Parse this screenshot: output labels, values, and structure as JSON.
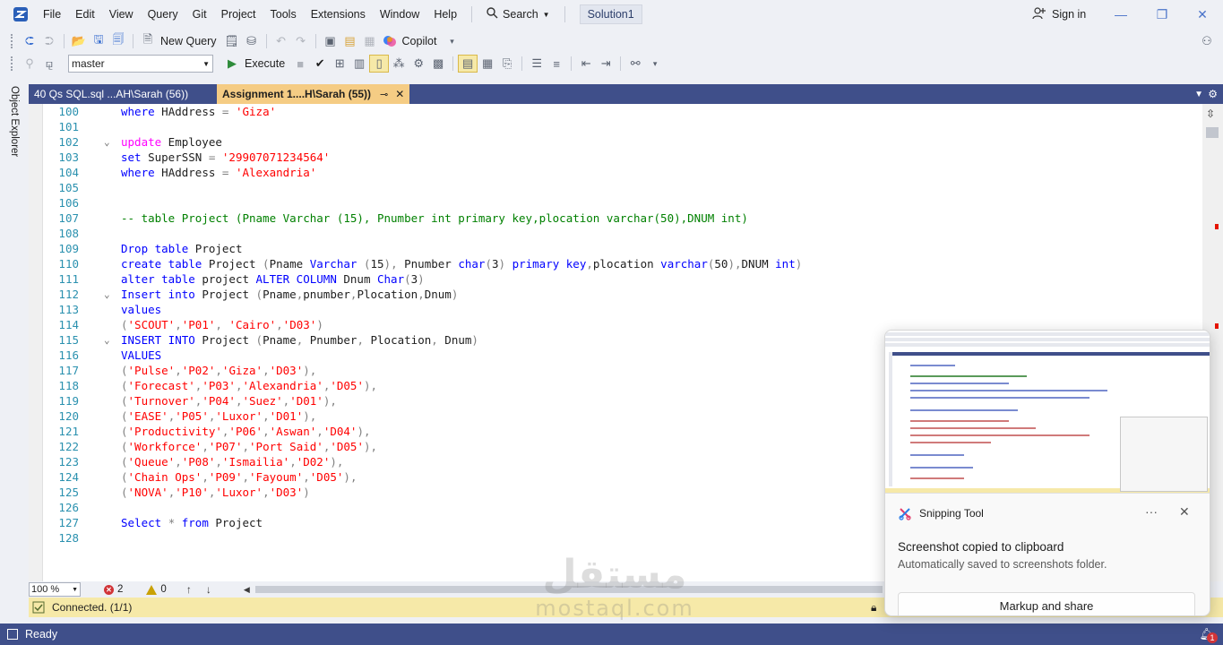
{
  "menubar": {
    "items": [
      "File",
      "Edit",
      "View",
      "Query",
      "Git",
      "Project",
      "Tools",
      "Extensions",
      "Window",
      "Help"
    ],
    "search_label": "Search",
    "solution_name": "Solution1",
    "signin_label": "Sign in"
  },
  "toolbar": {
    "new_query_label": "New Query",
    "copilot_label": "Copilot",
    "database": "master",
    "execute_label": "Execute"
  },
  "side_panel": {
    "label": "Object Explorer"
  },
  "tabs": [
    {
      "label": "40 Qs SQL.sql ...AH\\Sarah (56))",
      "active": false
    },
    {
      "label": "Assignment 1....H\\Sarah (55))",
      "active": true
    }
  ],
  "editor": {
    "lines": [
      {
        "num": "100",
        "tokens": [
          {
            "t": "k",
            "v": "where"
          },
          {
            "t": "t",
            "v": " HAddress "
          },
          {
            "t": "g",
            "v": "="
          },
          {
            "t": "t",
            "v": " "
          },
          {
            "t": "s",
            "v": "'Giza'"
          }
        ]
      },
      {
        "num": "101",
        "tokens": []
      },
      {
        "num": "102",
        "fold": true,
        "tokens": [
          {
            "t": "f",
            "v": "update"
          },
          {
            "t": "t",
            "v": " Employee"
          }
        ]
      },
      {
        "num": "103",
        "tokens": [
          {
            "t": "k",
            "v": "set"
          },
          {
            "t": "t",
            "v": " SuperSSN "
          },
          {
            "t": "g",
            "v": "="
          },
          {
            "t": "t",
            "v": " "
          },
          {
            "t": "s",
            "v": "'29907071234564'"
          }
        ]
      },
      {
        "num": "104",
        "tokens": [
          {
            "t": "k",
            "v": "where"
          },
          {
            "t": "t",
            "v": " HAddress "
          },
          {
            "t": "g",
            "v": "="
          },
          {
            "t": "t",
            "v": " "
          },
          {
            "t": "s",
            "v": "'Alexandria'"
          }
        ]
      },
      {
        "num": "105",
        "tokens": []
      },
      {
        "num": "106",
        "tokens": []
      },
      {
        "num": "107",
        "tokens": [
          {
            "t": "c",
            "v": "-- table Project (Pname Varchar (15), Pnumber int primary key,plocation varchar(50),DNUM int)"
          }
        ]
      },
      {
        "num": "108",
        "tokens": []
      },
      {
        "num": "109",
        "tokens": [
          {
            "t": "k",
            "v": "Drop table"
          },
          {
            "t": "t",
            "v": " Project"
          }
        ]
      },
      {
        "num": "110",
        "tokens": [
          {
            "t": "k",
            "v": "create table"
          },
          {
            "t": "t",
            "v": " Project "
          },
          {
            "t": "g",
            "v": "("
          },
          {
            "t": "t",
            "v": "Pname "
          },
          {
            "t": "k",
            "v": "Varchar"
          },
          {
            "t": "t",
            "v": " "
          },
          {
            "t": "g",
            "v": "("
          },
          {
            "t": "t",
            "v": "15"
          },
          {
            "t": "g",
            "v": "),"
          },
          {
            "t": "t",
            "v": " Pnumber "
          },
          {
            "t": "k",
            "v": "char"
          },
          {
            "t": "g",
            "v": "("
          },
          {
            "t": "t",
            "v": "3"
          },
          {
            "t": "g",
            "v": ")"
          },
          {
            "t": "t",
            "v": " "
          },
          {
            "t": "k",
            "v": "primary key"
          },
          {
            "t": "g",
            "v": ","
          },
          {
            "t": "t",
            "v": "plocation "
          },
          {
            "t": "k",
            "v": "varchar"
          },
          {
            "t": "g",
            "v": "("
          },
          {
            "t": "t",
            "v": "50"
          },
          {
            "t": "g",
            "v": "),"
          },
          {
            "t": "t",
            "v": "DNUM "
          },
          {
            "t": "k",
            "v": "int"
          },
          {
            "t": "g",
            "v": ")"
          }
        ]
      },
      {
        "num": "111",
        "tokens": [
          {
            "t": "k",
            "v": "alter table"
          },
          {
            "t": "t",
            "v": " project "
          },
          {
            "t": "k",
            "v": "ALTER COLUMN"
          },
          {
            "t": "t",
            "v": " Dnum "
          },
          {
            "t": "k",
            "v": "Char"
          },
          {
            "t": "g",
            "v": "("
          },
          {
            "t": "t",
            "v": "3"
          },
          {
            "t": "g",
            "v": ")"
          }
        ]
      },
      {
        "num": "112",
        "fold": true,
        "tokens": [
          {
            "t": "k",
            "v": "Insert into"
          },
          {
            "t": "t",
            "v": " Project "
          },
          {
            "t": "g",
            "v": "("
          },
          {
            "t": "t",
            "v": "Pname"
          },
          {
            "t": "g",
            "v": ","
          },
          {
            "t": "t",
            "v": "pnumber"
          },
          {
            "t": "g",
            "v": ","
          },
          {
            "t": "t",
            "v": "Plocation"
          },
          {
            "t": "g",
            "v": ","
          },
          {
            "t": "t",
            "v": "Dnum"
          },
          {
            "t": "g",
            "v": ")"
          }
        ]
      },
      {
        "num": "113",
        "tokens": [
          {
            "t": "k",
            "v": "values"
          }
        ]
      },
      {
        "num": "114",
        "tokens": [
          {
            "t": "g",
            "v": "("
          },
          {
            "t": "s",
            "v": "'SCOUT'"
          },
          {
            "t": "g",
            "v": ","
          },
          {
            "t": "s",
            "v": "'P01'"
          },
          {
            "t": "g",
            "v": ","
          },
          {
            "t": "t",
            "v": " "
          },
          {
            "t": "s",
            "v": "'Cairo'"
          },
          {
            "t": "g",
            "v": ","
          },
          {
            "t": "s",
            "v": "'D03'"
          },
          {
            "t": "g",
            "v": ")"
          }
        ]
      },
      {
        "num": "115",
        "fold": true,
        "tokens": [
          {
            "t": "k",
            "v": "INSERT INTO"
          },
          {
            "t": "t",
            "v": " Project "
          },
          {
            "t": "g",
            "v": "("
          },
          {
            "t": "t",
            "v": "Pname"
          },
          {
            "t": "g",
            "v": ","
          },
          {
            "t": "t",
            "v": " Pnumber"
          },
          {
            "t": "g",
            "v": ","
          },
          {
            "t": "t",
            "v": " Plocation"
          },
          {
            "t": "g",
            "v": ","
          },
          {
            "t": "t",
            "v": " Dnum"
          },
          {
            "t": "g",
            "v": ")"
          }
        ]
      },
      {
        "num": "116",
        "tokens": [
          {
            "t": "k",
            "v": "VALUES"
          }
        ]
      },
      {
        "num": "117",
        "tokens": [
          {
            "t": "g",
            "v": "("
          },
          {
            "t": "s",
            "v": "'Pulse'"
          },
          {
            "t": "g",
            "v": ","
          },
          {
            "t": "s",
            "v": "'P02'"
          },
          {
            "t": "g",
            "v": ","
          },
          {
            "t": "s",
            "v": "'Giza'"
          },
          {
            "t": "g",
            "v": ","
          },
          {
            "t": "s",
            "v": "'D03'"
          },
          {
            "t": "g",
            "v": "),"
          }
        ]
      },
      {
        "num": "118",
        "tokens": [
          {
            "t": "g",
            "v": "("
          },
          {
            "t": "s",
            "v": "'Forecast'"
          },
          {
            "t": "g",
            "v": ","
          },
          {
            "t": "s",
            "v": "'P03'"
          },
          {
            "t": "g",
            "v": ","
          },
          {
            "t": "s",
            "v": "'Alexandria'"
          },
          {
            "t": "g",
            "v": ","
          },
          {
            "t": "s",
            "v": "'D05'"
          },
          {
            "t": "g",
            "v": "),"
          }
        ]
      },
      {
        "num": "119",
        "tokens": [
          {
            "t": "g",
            "v": "("
          },
          {
            "t": "s",
            "v": "'Turnover'"
          },
          {
            "t": "g",
            "v": ","
          },
          {
            "t": "s",
            "v": "'P04'"
          },
          {
            "t": "g",
            "v": ","
          },
          {
            "t": "s",
            "v": "'Suez'"
          },
          {
            "t": "g",
            "v": ","
          },
          {
            "t": "s",
            "v": "'D01'"
          },
          {
            "t": "g",
            "v": "),"
          }
        ]
      },
      {
        "num": "120",
        "tokens": [
          {
            "t": "g",
            "v": "("
          },
          {
            "t": "s",
            "v": "'EASE'"
          },
          {
            "t": "g",
            "v": ","
          },
          {
            "t": "s",
            "v": "'P05'"
          },
          {
            "t": "g",
            "v": ","
          },
          {
            "t": "s",
            "v": "'Luxor'"
          },
          {
            "t": "g",
            "v": ","
          },
          {
            "t": "s",
            "v": "'D01'"
          },
          {
            "t": "g",
            "v": "),"
          }
        ]
      },
      {
        "num": "121",
        "tokens": [
          {
            "t": "g",
            "v": "("
          },
          {
            "t": "s",
            "v": "'Productivity'"
          },
          {
            "t": "g",
            "v": ","
          },
          {
            "t": "s",
            "v": "'P06'"
          },
          {
            "t": "g",
            "v": ","
          },
          {
            "t": "s",
            "v": "'Aswan'"
          },
          {
            "t": "g",
            "v": ","
          },
          {
            "t": "s",
            "v": "'D04'"
          },
          {
            "t": "g",
            "v": "),"
          }
        ]
      },
      {
        "num": "122",
        "tokens": [
          {
            "t": "g",
            "v": "("
          },
          {
            "t": "s",
            "v": "'Workforce'"
          },
          {
            "t": "g",
            "v": ","
          },
          {
            "t": "s",
            "v": "'P07'"
          },
          {
            "t": "g",
            "v": ","
          },
          {
            "t": "s",
            "v": "'Port Said'"
          },
          {
            "t": "g",
            "v": ","
          },
          {
            "t": "s",
            "v": "'D05'"
          },
          {
            "t": "g",
            "v": "),"
          }
        ]
      },
      {
        "num": "123",
        "tokens": [
          {
            "t": "g",
            "v": "("
          },
          {
            "t": "s",
            "v": "'Queue'"
          },
          {
            "t": "g",
            "v": ","
          },
          {
            "t": "s",
            "v": "'P08'"
          },
          {
            "t": "g",
            "v": ","
          },
          {
            "t": "s",
            "v": "'Ismailia'"
          },
          {
            "t": "g",
            "v": ","
          },
          {
            "t": "s",
            "v": "'D02'"
          },
          {
            "t": "g",
            "v": "),"
          }
        ]
      },
      {
        "num": "124",
        "tokens": [
          {
            "t": "g",
            "v": "("
          },
          {
            "t": "s",
            "v": "'Chain Ops'"
          },
          {
            "t": "g",
            "v": ","
          },
          {
            "t": "s",
            "v": "'P09'"
          },
          {
            "t": "g",
            "v": ","
          },
          {
            "t": "s",
            "v": "'Fayoum'"
          },
          {
            "t": "g",
            "v": ","
          },
          {
            "t": "s",
            "v": "'D05'"
          },
          {
            "t": "g",
            "v": "),"
          }
        ]
      },
      {
        "num": "125",
        "tokens": [
          {
            "t": "g",
            "v": "("
          },
          {
            "t": "s",
            "v": "'NOVA'"
          },
          {
            "t": "g",
            "v": ","
          },
          {
            "t": "s",
            "v": "'P10'"
          },
          {
            "t": "g",
            "v": ","
          },
          {
            "t": "s",
            "v": "'Luxor'"
          },
          {
            "t": "g",
            "v": ","
          },
          {
            "t": "s",
            "v": "'D03'"
          },
          {
            "t": "g",
            "v": ")"
          }
        ]
      },
      {
        "num": "126",
        "tokens": []
      },
      {
        "num": "127",
        "tokens": [
          {
            "t": "k",
            "v": "Select"
          },
          {
            "t": "t",
            "v": " "
          },
          {
            "t": "g",
            "v": "*"
          },
          {
            "t": "t",
            "v": " "
          },
          {
            "t": "k",
            "v": "from"
          },
          {
            "t": "t",
            "v": " Project"
          }
        ]
      },
      {
        "num": "128",
        "tokens": []
      }
    ]
  },
  "editor_status": {
    "zoom": "100 %",
    "errors": "2",
    "warnings": "0"
  },
  "connection": {
    "status": "Connected. (1/1)"
  },
  "statusbar": {
    "text": "Ready",
    "notifications": "1"
  },
  "toast": {
    "app_name": "Snipping Tool",
    "title": "Screenshot copied to clipboard",
    "body": "Automatically saved to screenshots folder.",
    "action_label": "Markup and share",
    "more_label": "···",
    "close_label": "✕"
  },
  "watermark": {
    "logo": "مستقل",
    "text": "mostaql.com"
  },
  "colors": {
    "keyword": "#0000ff",
    "function": "#ff00ff",
    "string": "#ff0000",
    "comment": "#008000",
    "operator": "#808080",
    "tab_strip": "#3f4f8a",
    "active_tab": "#f5cc84",
    "connection_bar": "#f6e9a8"
  }
}
